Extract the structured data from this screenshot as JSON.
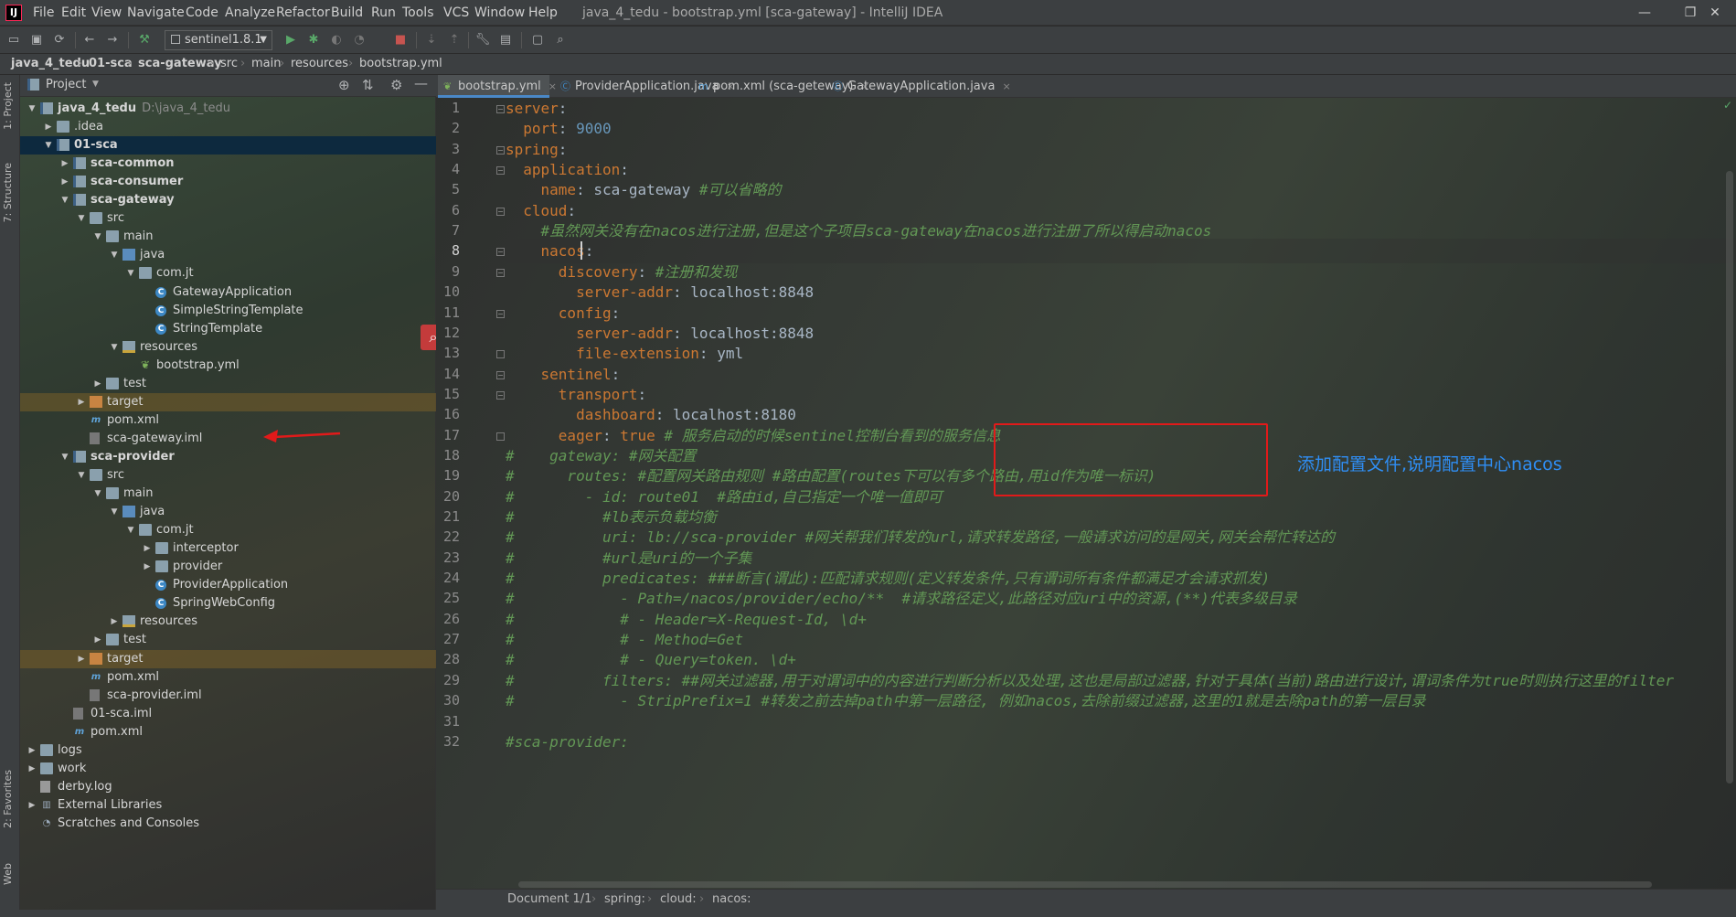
{
  "app": {
    "logo": "IJ",
    "window_title": "java_4_tedu - bootstrap.yml [sca-gateway] - IntelliJ IDEA"
  },
  "menu": [
    "File",
    "Edit",
    "View",
    "Navigate",
    "Code",
    "Analyze",
    "Refactor",
    "Build",
    "Run",
    "Tools",
    "VCS",
    "Window",
    "Help"
  ],
  "window_controls": {
    "minimize": "—",
    "restore": "❐",
    "close": "✕"
  },
  "toolbar": {
    "run_config": "sentinel1.8.1"
  },
  "breadcrumbs": [
    "java_4_tedu",
    "01-sca",
    "sca-gateway",
    "src",
    "main",
    "resources",
    "bootstrap.yml"
  ],
  "side_tabs": {
    "project": "1: Project",
    "structure": "7: Structure",
    "favorites": "2: Favorites",
    "web": "Web"
  },
  "project_panel": {
    "title": "Project"
  },
  "tree": [
    {
      "label": "java_4_tedu",
      "path": "D:\\java_4_tedu",
      "bold": true,
      "arrow": "down",
      "icon": "folder-mod"
    },
    {
      "label": ".idea",
      "arrow": "right",
      "icon": "folder"
    },
    {
      "label": "01-sca",
      "bold": true,
      "arrow": "down",
      "icon": "folder-mod",
      "selected": true
    },
    {
      "label": "sca-common",
      "bold": true,
      "arrow": "right",
      "icon": "folder-mod"
    },
    {
      "label": "sca-consumer",
      "bold": true,
      "arrow": "right",
      "icon": "folder-mod"
    },
    {
      "label": "sca-gateway",
      "bold": true,
      "arrow": "down",
      "icon": "folder-mod"
    },
    {
      "label": "src",
      "arrow": "down",
      "icon": "folder"
    },
    {
      "label": "main",
      "arrow": "down",
      "icon": "folder"
    },
    {
      "label": "java",
      "arrow": "down",
      "icon": "folder-src"
    },
    {
      "label": "com.jt",
      "arrow": "down",
      "icon": "folder"
    },
    {
      "label": "GatewayApplication",
      "icon": "class"
    },
    {
      "label": "SimpleStringTemplate",
      "icon": "class"
    },
    {
      "label": "StringTemplate",
      "icon": "class"
    },
    {
      "label": "resources",
      "arrow": "down",
      "icon": "folder-res"
    },
    {
      "label": "bootstrap.yml",
      "icon": "yml"
    },
    {
      "label": "test",
      "arrow": "right",
      "icon": "folder"
    },
    {
      "label": "target",
      "arrow": "right",
      "icon": "folder-ex",
      "excluded": true
    },
    {
      "label": "pom.xml",
      "icon": "m"
    },
    {
      "label": "sca-gateway.iml",
      "icon": "iml"
    },
    {
      "label": "sca-provider",
      "bold": true,
      "arrow": "down",
      "icon": "folder-mod"
    },
    {
      "label": "src",
      "arrow": "down",
      "icon": "folder"
    },
    {
      "label": "main",
      "arrow": "down",
      "icon": "folder"
    },
    {
      "label": "java",
      "arrow": "down",
      "icon": "folder-src"
    },
    {
      "label": "com.jt",
      "arrow": "down",
      "icon": "folder"
    },
    {
      "label": "interceptor",
      "arrow": "right",
      "icon": "folder"
    },
    {
      "label": "provider",
      "arrow": "right",
      "icon": "folder"
    },
    {
      "label": "ProviderApplication",
      "icon": "class"
    },
    {
      "label": "SpringWebConfig",
      "icon": "class"
    },
    {
      "label": "resources",
      "arrow": "right",
      "icon": "folder-res"
    },
    {
      "label": "test",
      "arrow": "right",
      "icon": "folder"
    },
    {
      "label": "target",
      "arrow": "right",
      "icon": "folder-ex",
      "excluded": true
    },
    {
      "label": "pom.xml",
      "icon": "m"
    },
    {
      "label": "sca-provider.iml",
      "icon": "iml"
    },
    {
      "label": "01-sca.iml",
      "icon": "iml"
    },
    {
      "label": "pom.xml",
      "icon": "m"
    },
    {
      "label": "logs",
      "arrow": "right",
      "icon": "folder"
    },
    {
      "label": "work",
      "arrow": "right",
      "icon": "folder"
    },
    {
      "label": "derby.log",
      "icon": "txt"
    },
    {
      "label": "External Libraries",
      "arrow": "right",
      "icon": "lib"
    },
    {
      "label": "Scratches and Consoles",
      "arrow": null,
      "icon": "scratch"
    }
  ],
  "tabs": [
    {
      "label": "bootstrap.yml",
      "active": true,
      "icon": "yml"
    },
    {
      "label": "ProviderApplication.java",
      "active": false,
      "icon": "class"
    },
    {
      "label": "pom.xml (sca-geteway)",
      "active": false,
      "icon": "m"
    },
    {
      "label": "GatewayApplication.java",
      "active": false,
      "icon": "class"
    }
  ],
  "code_lines": [
    [
      [
        "k",
        "server"
      ],
      [
        "v",
        ":"
      ]
    ],
    [
      [
        "v",
        "  "
      ],
      [
        "k",
        "port"
      ],
      [
        "v",
        ": "
      ],
      [
        "n",
        "9000"
      ]
    ],
    [
      [
        "k",
        "spring"
      ],
      [
        "v",
        ":"
      ]
    ],
    [
      [
        "v",
        "  "
      ],
      [
        "k",
        "application"
      ],
      [
        "v",
        ":"
      ]
    ],
    [
      [
        "v",
        "    "
      ],
      [
        "k",
        "name"
      ],
      [
        "v",
        ": sca-gateway "
      ],
      [
        "c",
        "#可以省略的"
      ]
    ],
    [
      [
        "v",
        "  "
      ],
      [
        "k",
        "cloud"
      ],
      [
        "v",
        ":"
      ]
    ],
    [
      [
        "v",
        "    "
      ],
      [
        "c",
        "#虽然网关没有在nacos进行注册,但是这个子项目sca-gateway在nacos进行注册了所以得启动nacos"
      ]
    ],
    [
      [
        "v",
        "    "
      ],
      [
        "k",
        "nacos"
      ],
      [
        "v",
        ":"
      ]
    ],
    [
      [
        "v",
        "      "
      ],
      [
        "k",
        "discovery"
      ],
      [
        "v",
        ": "
      ],
      [
        "c",
        "#注册和发现"
      ]
    ],
    [
      [
        "v",
        "        "
      ],
      [
        "k",
        "server-addr"
      ],
      [
        "v",
        ": localhost:8848"
      ]
    ],
    [
      [
        "v",
        "      "
      ],
      [
        "k",
        "config"
      ],
      [
        "v",
        ":"
      ]
    ],
    [
      [
        "v",
        "        "
      ],
      [
        "k",
        "server-addr"
      ],
      [
        "v",
        ": localhost:8848"
      ]
    ],
    [
      [
        "v",
        "        "
      ],
      [
        "k",
        "file-extension"
      ],
      [
        "v",
        ": yml"
      ]
    ],
    [
      [
        "v",
        "    "
      ],
      [
        "k",
        "sentinel"
      ],
      [
        "v",
        ":"
      ]
    ],
    [
      [
        "v",
        "      "
      ],
      [
        "k",
        "transport"
      ],
      [
        "v",
        ":"
      ]
    ],
    [
      [
        "v",
        "        "
      ],
      [
        "k",
        "dashboard"
      ],
      [
        "v",
        ": localhost:8180"
      ]
    ],
    [
      [
        "v",
        "      "
      ],
      [
        "k",
        "eager"
      ],
      [
        "v",
        ": "
      ],
      [
        "k",
        "true "
      ],
      [
        "c",
        "# 服务启动的时候sentinel控制台看到的服务信息"
      ]
    ],
    [
      [
        "c",
        "#    gateway: #网关配置"
      ]
    ],
    [
      [
        "c",
        "#      routes: #配置网关路由规则 #路由配置(routes下可以有多个路由,用id作为唯一标识)"
      ]
    ],
    [
      [
        "c",
        "#        - id: route01  #路由id,自己指定一个唯一值即可"
      ]
    ],
    [
      [
        "c",
        "#          #lb表示负载均衡"
      ]
    ],
    [
      [
        "c",
        "#          uri: lb://sca-provider #网关帮我们转发的url,请求转发路径,一般请求访问的是网关,网关会帮忙转达的"
      ]
    ],
    [
      [
        "c",
        "#          #url是uri的一个子集"
      ]
    ],
    [
      [
        "c",
        "#          predicates: ###断言(谓此):匹配请求规则(定义转发条件,只有谓词所有条件都满足才会请求抓发)"
      ]
    ],
    [
      [
        "c",
        "#            - Path=/nacos/provider/echo/**  #请求路径定义,此路径对应uri中的资源,(**)代表多级目录"
      ]
    ],
    [
      [
        "c",
        "#            # - Header=X-Request-Id, \\d+"
      ]
    ],
    [
      [
        "c",
        "#            # - Method=Get"
      ]
    ],
    [
      [
        "c",
        "#            # - Query=token. \\d+"
      ]
    ],
    [
      [
        "c",
        "#          filters: ##网关过滤器,用于对谓词中的内容进行判断分析以及处理,这也是局部过滤器,针对于具体(当前)路由进行设计,谓词条件为true时则执行这里的filter"
      ]
    ],
    [
      [
        "c",
        "#            - StripPrefix=1 #转发之前去掉path中第一层路径, 例如nacos,去除前缀过滤器,这里的1就是去除path的第一层目录"
      ]
    ],
    [],
    [
      [
        "c",
        "#sca-provider:"
      ]
    ]
  ],
  "annotation": "添加配置文件,说明配置中心nacos",
  "status": {
    "doc": "Document 1/1",
    "path": [
      "spring:",
      "cloud:",
      "nacos:"
    ]
  }
}
